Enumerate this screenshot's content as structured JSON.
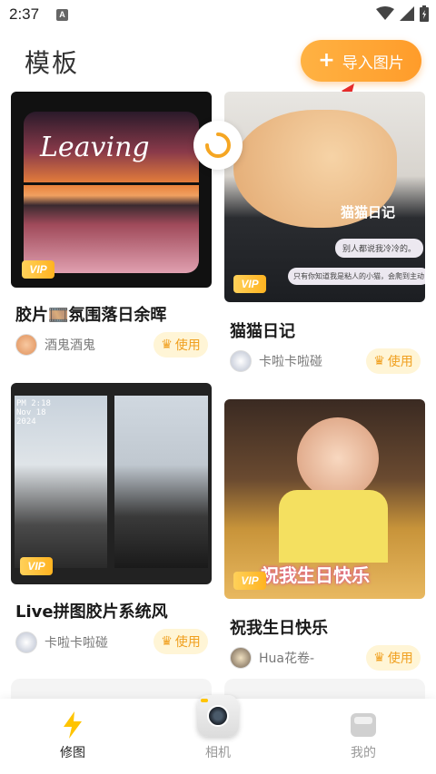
{
  "status_bar": {
    "time": "2:37",
    "notif_letter": "A"
  },
  "header": {
    "title": "模板",
    "import_button": "导入图片"
  },
  "cards": [
    {
      "title": "胶片🎞️氛围落日余晖",
      "author": "酒鬼酒鬼",
      "use_label": "使用",
      "vip": "VIP",
      "image_text": "Leaving"
    },
    {
      "title": "猫猫日记",
      "author": "卡啦卡啦碰",
      "use_label": "使用",
      "vip": "VIP",
      "image_text": "猫猫日记",
      "bubble1": "别人都说我冷冷的。",
      "bubble2": "只有你知道我是粘人的小猫，会爬到主动"
    },
    {
      "title": "Live拼图胶片系统风",
      "author": "卡啦卡啦碰",
      "use_label": "使用",
      "vip": "VIP",
      "image_text": "PM 2:18 Nov 18 2024"
    },
    {
      "title": "祝我生日快乐",
      "author": "Hua花卷-",
      "use_label": "使用",
      "vip": "VIP",
      "image_text": "祝我生日快乐"
    }
  ],
  "bottom_nav": [
    {
      "label": "修图",
      "active": true
    },
    {
      "label": "相机",
      "active": false
    },
    {
      "label": "我的",
      "active": false
    }
  ],
  "colors": {
    "accent": "#ff9c2a",
    "use_bg": "#fff5d6",
    "vip": "#ffb320"
  }
}
